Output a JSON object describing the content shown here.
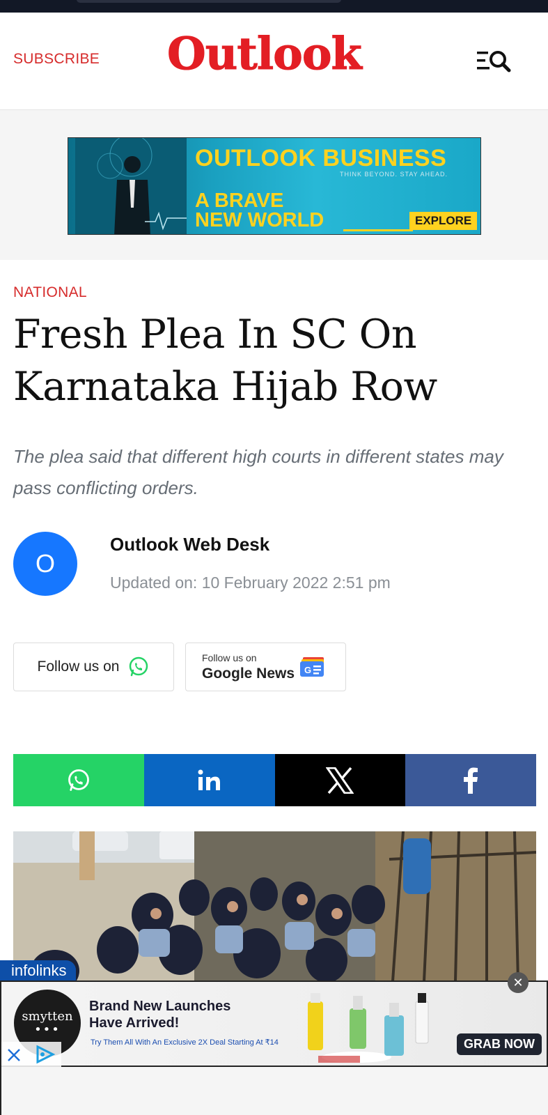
{
  "header": {
    "subscribe_label": "SUBSCRIBE",
    "logo_text": "Outlook",
    "menu_icon": "menu-search-icon"
  },
  "top_ad": {
    "title": "OUTLOOK BUSINESS",
    "tagline": "THINK BEYOND. STAY AHEAD.",
    "line1": "A BRAVE",
    "line2": "NEW WORLD",
    "cta": "EXPLORE"
  },
  "article": {
    "category": "NATIONAL",
    "headline": "Fresh Plea In SC On Karnataka Hijab Row",
    "summary": "The plea said that different high courts in different states may pass conflicting orders.",
    "author_initial": "O",
    "author": "Outlook Web Desk",
    "updated": "Updated on: 10 February 2022 2:51 pm"
  },
  "follow": {
    "whatsapp_label": "Follow us on",
    "google_small": "Follow us on",
    "google_big": "Google News"
  },
  "share": [
    {
      "name": "whatsapp",
      "icon": "whatsapp-icon",
      "color": "#25d366"
    },
    {
      "name": "linkedin",
      "icon": "linkedin-icon",
      "color": "#0a66c2"
    },
    {
      "name": "x",
      "icon": "x-icon",
      "color": "#000000"
    },
    {
      "name": "facebook",
      "icon": "facebook-icon",
      "color": "#3b5998"
    }
  ],
  "bottom_ad": {
    "network": "infolinks",
    "brand": "smytten",
    "headline1": "Brand New Launches",
    "headline2": "Have Arrived!",
    "sub": "Try Them All With An Exclusive 2X Deal Starting At ₹14",
    "cta": "GRAB NOW",
    "close": "✕"
  },
  "colors": {
    "brand_red": "#e31e24",
    "category_red": "#d62b2b",
    "avatar_blue": "#1677ff"
  }
}
